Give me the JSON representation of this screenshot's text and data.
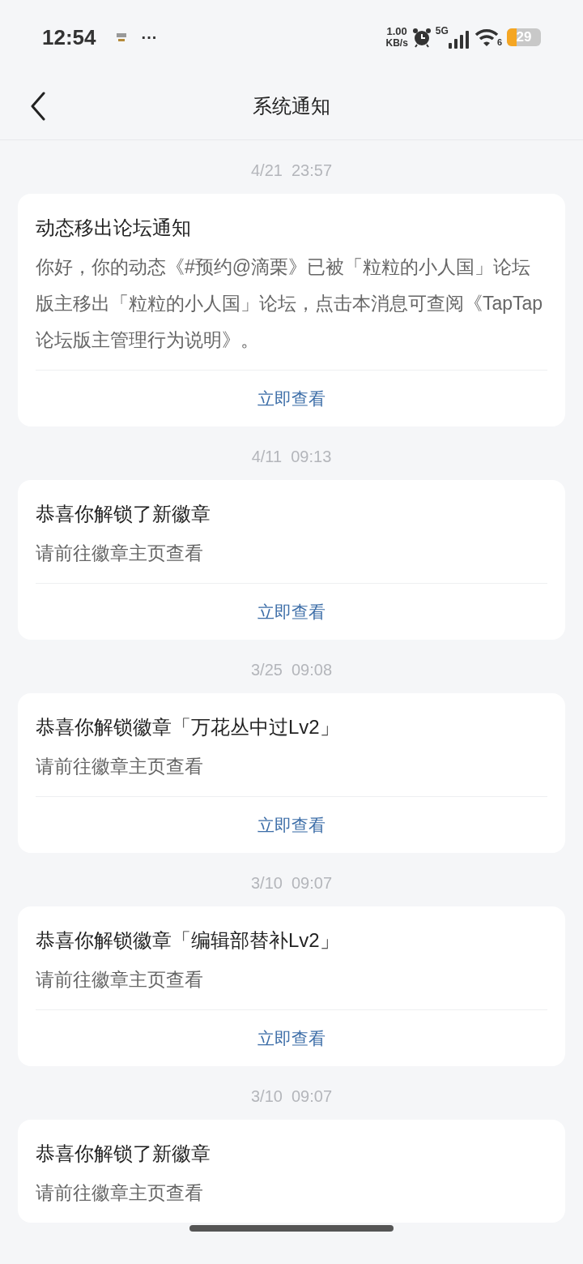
{
  "status_bar": {
    "time": "12:54",
    "more": "···",
    "net_speed_value": "1.00",
    "net_speed_unit": "KB/s",
    "network": "5G",
    "wifi_number": "6",
    "battery": "29"
  },
  "header": {
    "title": "系统通知"
  },
  "notifications": [
    {
      "date": "4/21  23:57",
      "title": "动态移出论坛通知",
      "body": "你好，你的动态《#预约@滴栗》已被「粒粒的小人国」论坛版主移出「粒粒的小人国」论坛，点击本消息可查阅《TapTap论坛版主管理行为说明》。",
      "action": "立即查看"
    },
    {
      "date": "4/11  09:13",
      "title": "恭喜你解锁了新徽章",
      "body": "请前往徽章主页查看",
      "action": "立即查看"
    },
    {
      "date": "3/25  09:08",
      "title": "恭喜你解锁徽章「万花丛中过Lv2」",
      "body": "请前往徽章主页查看",
      "action": "立即查看"
    },
    {
      "date": "3/10  09:07",
      "title": "恭喜你解锁徽章「编辑部替补Lv2」",
      "body": "请前往徽章主页查看",
      "action": "立即查看"
    },
    {
      "date": "3/10  09:07",
      "title": "恭喜你解锁了新徽章",
      "body": "请前往徽章主页查看"
    }
  ]
}
